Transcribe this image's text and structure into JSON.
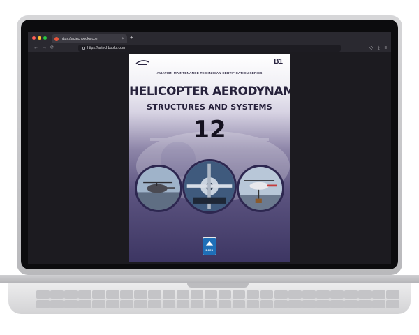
{
  "browser": {
    "tab_title": "https://actechbooks.com",
    "url": "https://actechbooks.com",
    "new_tab_label": "+",
    "close_label": "×",
    "nav": {
      "back": "←",
      "forward": "→",
      "reload": "⟳"
    },
    "icons": [
      "shield-icon",
      "download-icon",
      "menu-icon"
    ]
  },
  "cover": {
    "module_code": "B1",
    "series_label": "AVIATION MAINTENANCE TECHNICIAN CERTIFICATION SERIES",
    "title": "HELICOPTER AERODYNAMICS",
    "subtitle": "STRUCTURES AND SYSTEMS",
    "module_number": "12",
    "badge_text": "EASA",
    "colors": {
      "title": "#26213b",
      "ring": "#2d2750",
      "badge": "#1f6fb8"
    }
  }
}
